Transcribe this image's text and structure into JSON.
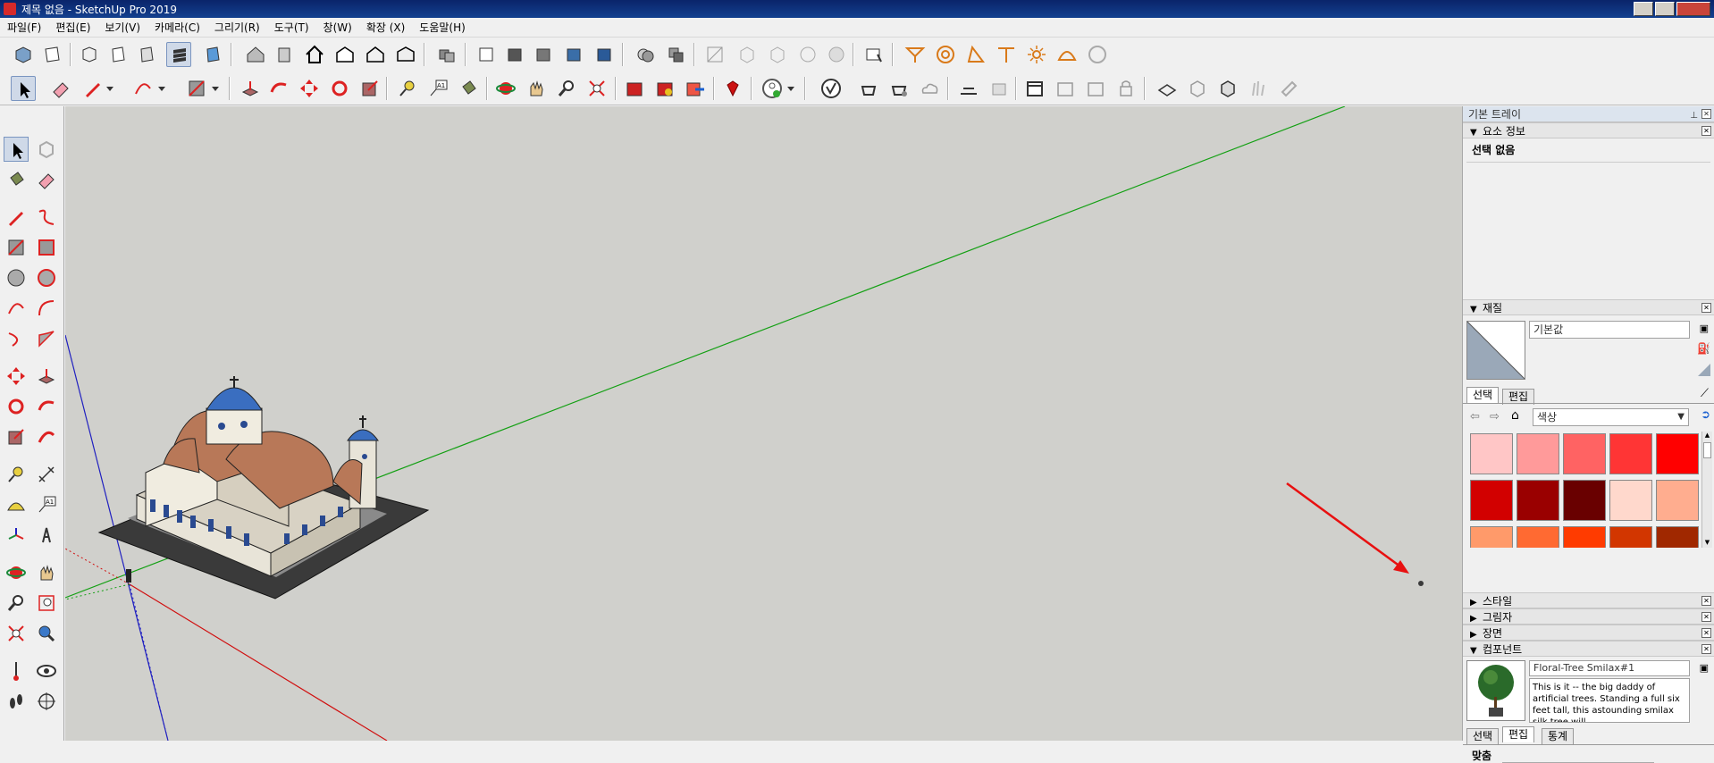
{
  "window": {
    "title": "제목 없음 - SketchUp Pro 2019"
  },
  "menu": [
    "파일(F)",
    "편집(E)",
    "보기(V)",
    "카메라(C)",
    "그리기(R)",
    "도구(T)",
    "창(W)",
    "확장 (X)",
    "도움말(H)"
  ],
  "tray": {
    "title": "기본 트레이",
    "entity_info": {
      "header": "요소 정보",
      "value": "선택 없음"
    },
    "materials": {
      "header": "재질",
      "name": "기본값",
      "tabs": [
        "선택",
        "편집"
      ],
      "library": "색상",
      "swatches": [
        "#ffc6c6",
        "#ff9a9a",
        "#ff6363",
        "#ff3535",
        "#ff0000",
        "#d20000",
        "#9a0000",
        "#690000",
        "#ffd8cc",
        "#ffad8f",
        "#ff9a6a",
        "#ff6a32",
        "#ff3b00",
        "#d23600",
        "#a02800"
      ]
    },
    "collapsed_panels": [
      "스타일",
      "그림자",
      "장면"
    ],
    "components": {
      "header": "컴포넌트",
      "name": "Floral-Tree Smilax#1",
      "description": "This is it -- the big daddy of artificial trees. Standing a full six feet tall, this astounding smilax silk tree will",
      "tabs": [
        "선택",
        "편집",
        "통계"
      ],
      "section_label": "맞춤"
    }
  },
  "colors": {
    "axis_red": "#d01010",
    "axis_green": "#14a014",
    "axis_blue": "#2020c0",
    "background": "#d0d0cc",
    "annotation_arrow": "#e81010"
  }
}
